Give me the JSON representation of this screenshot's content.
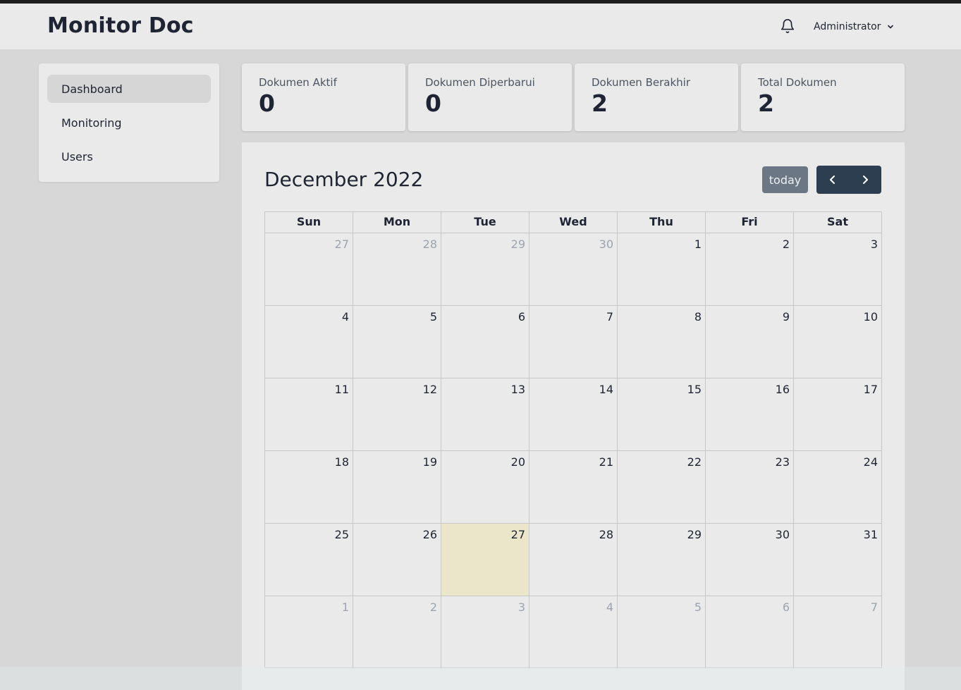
{
  "app": {
    "brand": "Monitor Doc"
  },
  "header": {
    "user_name": "Administrator"
  },
  "sidebar": {
    "items": [
      {
        "label": "Dashboard",
        "active": true
      },
      {
        "label": "Monitoring",
        "active": false
      },
      {
        "label": "Users",
        "active": false
      }
    ]
  },
  "stats": [
    {
      "label": "Dokumen Aktif",
      "value": "0"
    },
    {
      "label": "Dokumen Diperbarui",
      "value": "0"
    },
    {
      "label": "Dokumen Berakhir",
      "value": "2"
    },
    {
      "label": "Total Dokumen",
      "value": "2"
    }
  ],
  "calendar": {
    "title": "December 2022",
    "today_label": "today",
    "weekdays": [
      "Sun",
      "Mon",
      "Tue",
      "Wed",
      "Thu",
      "Fri",
      "Sat"
    ],
    "weeks": [
      [
        {
          "d": "27",
          "o": true
        },
        {
          "d": "28",
          "o": true
        },
        {
          "d": "29",
          "o": true
        },
        {
          "d": "30",
          "o": true
        },
        {
          "d": "1"
        },
        {
          "d": "2"
        },
        {
          "d": "3"
        }
      ],
      [
        {
          "d": "4"
        },
        {
          "d": "5"
        },
        {
          "d": "6"
        },
        {
          "d": "7"
        },
        {
          "d": "8"
        },
        {
          "d": "9"
        },
        {
          "d": "10"
        }
      ],
      [
        {
          "d": "11"
        },
        {
          "d": "12"
        },
        {
          "d": "13"
        },
        {
          "d": "14"
        },
        {
          "d": "15"
        },
        {
          "d": "16"
        },
        {
          "d": "17"
        }
      ],
      [
        {
          "d": "18"
        },
        {
          "d": "19"
        },
        {
          "d": "20"
        },
        {
          "d": "21"
        },
        {
          "d": "22"
        },
        {
          "d": "23"
        },
        {
          "d": "24"
        }
      ],
      [
        {
          "d": "25"
        },
        {
          "d": "26"
        },
        {
          "d": "27",
          "today": true
        },
        {
          "d": "28"
        },
        {
          "d": "29"
        },
        {
          "d": "30"
        },
        {
          "d": "31"
        }
      ],
      [
        {
          "d": "1",
          "o": true
        },
        {
          "d": "2",
          "o": true
        },
        {
          "d": "3",
          "o": true
        },
        {
          "d": "4",
          "o": true
        },
        {
          "d": "5",
          "o": true
        },
        {
          "d": "6",
          "o": true
        },
        {
          "d": "7",
          "o": true
        }
      ]
    ]
  },
  "colors": {
    "nav_button": "#2c3e50",
    "today_button": "#6b7785",
    "today_cell": "#ebe6c9"
  }
}
